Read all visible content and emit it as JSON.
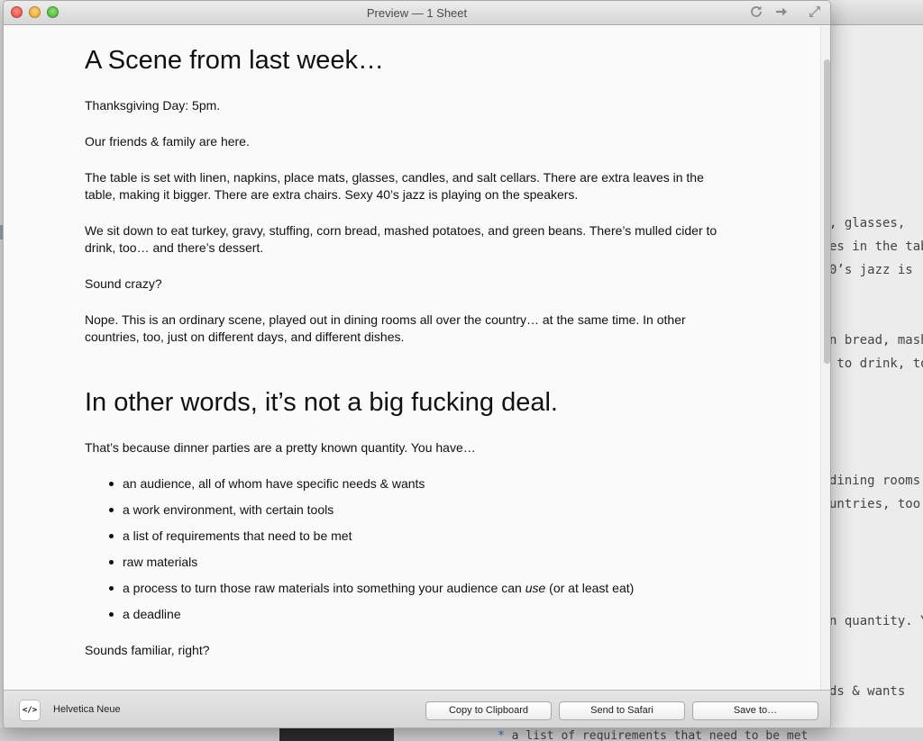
{
  "background_editor": {
    "lines": [
      ", glasses,",
      "es in the tab",
      "0’s jazz is",
      "n bread, mash",
      " to drink, to",
      "dining rooms",
      "untries, too,",
      "n quantity. Y",
      "ds & wants"
    ],
    "bottom_bullet": "*",
    "bottom_line": " a list of requirements that need to be met"
  },
  "window": {
    "title": "Preview — 1 Sheet"
  },
  "icons": {
    "reload": "reload-icon",
    "forward": "forward-arrow-icon",
    "fullscreen": "fullscreen-icon"
  },
  "document": {
    "heading1": "A Scene from last week…",
    "paragraphs": [
      "Thanksgiving Day: 5pm.",
      "Our friends & family are here.",
      "The table is set with linen, napkins, place mats, glasses, candles, and salt cellars. There are extra leaves in the table, making it bigger. There are extra chairs. Sexy 40’s jazz is playing on the speakers.",
      "We sit down to eat turkey, gravy, stuffing, corn bread, mashed potatoes, and green beans. There’s mulled cider to drink, too… and there’s dessert.",
      "Sound crazy?",
      "Nope. This is an ordinary scene, played out in dining rooms all over the country… at the same time. In other countries, too, just on different days, and different dishes."
    ],
    "heading2": "In other words, it’s not a big fucking deal.",
    "intro": "That’s because dinner parties are a pretty known quantity. You have…",
    "list": [
      "an audience, all of whom have specific needs & wants",
      "a work environment, with certain tools",
      "a list of requirements that need to be met",
      "raw materials",
      "a deadline"
    ],
    "process_item": {
      "before": "a process to turn those raw materials into something your audience can ",
      "emphasis": "use",
      "after": " (or at least eat)"
    },
    "closing": "Sounds familiar, right?"
  },
  "footer": {
    "badge": "</>",
    "font_name": "Helvetica Neue",
    "copy_label": "Copy to Clipboard",
    "safari_label": "Send to Safari",
    "save_label": "Save to…"
  }
}
